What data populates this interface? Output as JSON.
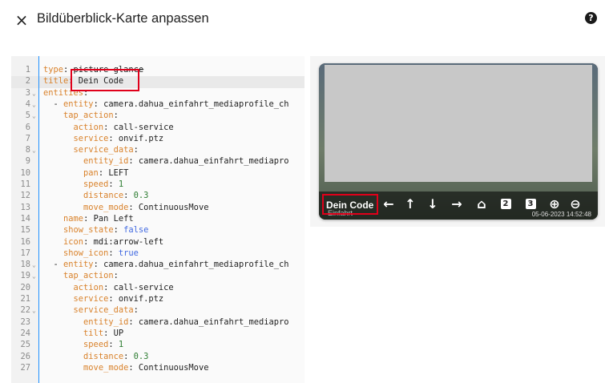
{
  "dialog": {
    "title": "Bildüberblick-Karte anpassen",
    "close_icon": "×",
    "help_icon": "?"
  },
  "editor": {
    "lines": [
      {
        "n": "1",
        "fold": "",
        "segs": [
          {
            "t": "type",
            "c": "k"
          },
          {
            "t": ": ",
            "c": "v"
          },
          {
            "t": "picture-glance",
            "c": "v",
            "s": "strike"
          }
        ]
      },
      {
        "n": "2",
        "fold": "",
        "active": true,
        "segs": [
          {
            "t": "title",
            "c": "k"
          },
          {
            "t": ": Dein Code",
            "c": "v"
          }
        ]
      },
      {
        "n": "3",
        "fold": "⌄",
        "segs": [
          {
            "t": "entities",
            "c": "k"
          },
          {
            "t": ":",
            "c": "v"
          }
        ]
      },
      {
        "n": "4",
        "fold": "⌄",
        "segs": [
          {
            "t": "  - ",
            "c": "dash"
          },
          {
            "t": "entity",
            "c": "k"
          },
          {
            "t": ": camera.dahua_einfahrt_mediaprofile_ch",
            "c": "v"
          }
        ]
      },
      {
        "n": "5",
        "fold": "⌄",
        "segs": [
          {
            "t": "    ",
            "c": "v"
          },
          {
            "t": "tap_action",
            "c": "k"
          },
          {
            "t": ":",
            "c": "v"
          }
        ]
      },
      {
        "n": "6",
        "fold": "",
        "segs": [
          {
            "t": "      ",
            "c": "v"
          },
          {
            "t": "action",
            "c": "k"
          },
          {
            "t": ": call-service",
            "c": "v"
          }
        ]
      },
      {
        "n": "7",
        "fold": "",
        "segs": [
          {
            "t": "      ",
            "c": "v"
          },
          {
            "t": "service",
            "c": "k"
          },
          {
            "t": ": onvif.ptz",
            "c": "v"
          }
        ]
      },
      {
        "n": "8",
        "fold": "⌄",
        "segs": [
          {
            "t": "      ",
            "c": "v"
          },
          {
            "t": "service_data",
            "c": "k"
          },
          {
            "t": ":",
            "c": "v"
          }
        ]
      },
      {
        "n": "9",
        "fold": "",
        "segs": [
          {
            "t": "        ",
            "c": "v"
          },
          {
            "t": "entity_id",
            "c": "k"
          },
          {
            "t": ": camera.dahua_einfahrt_mediapro",
            "c": "v"
          }
        ]
      },
      {
        "n": "10",
        "fold": "",
        "segs": [
          {
            "t": "        ",
            "c": "v"
          },
          {
            "t": "pan",
            "c": "k"
          },
          {
            "t": ": LEFT",
            "c": "v"
          }
        ]
      },
      {
        "n": "11",
        "fold": "",
        "segs": [
          {
            "t": "        ",
            "c": "v"
          },
          {
            "t": "speed",
            "c": "k"
          },
          {
            "t": ": ",
            "c": "v"
          },
          {
            "t": "1",
            "c": "n"
          }
        ]
      },
      {
        "n": "12",
        "fold": "",
        "segs": [
          {
            "t": "        ",
            "c": "v"
          },
          {
            "t": "distance",
            "c": "k"
          },
          {
            "t": ": ",
            "c": "v"
          },
          {
            "t": "0.3",
            "c": "n"
          }
        ]
      },
      {
        "n": "13",
        "fold": "",
        "segs": [
          {
            "t": "        ",
            "c": "v"
          },
          {
            "t": "move_mode",
            "c": "k"
          },
          {
            "t": ": ContinuousMove",
            "c": "v"
          }
        ]
      },
      {
        "n": "14",
        "fold": "",
        "segs": [
          {
            "t": "    ",
            "c": "v"
          },
          {
            "t": "name",
            "c": "k"
          },
          {
            "t": ": Pan Left",
            "c": "v"
          }
        ]
      },
      {
        "n": "15",
        "fold": "",
        "segs": [
          {
            "t": "    ",
            "c": "v"
          },
          {
            "t": "show_state",
            "c": "k"
          },
          {
            "t": ": ",
            "c": "v"
          },
          {
            "t": "false",
            "c": "b"
          }
        ]
      },
      {
        "n": "16",
        "fold": "",
        "segs": [
          {
            "t": "    ",
            "c": "v"
          },
          {
            "t": "icon",
            "c": "k"
          },
          {
            "t": ": mdi:arrow-left",
            "c": "v"
          }
        ]
      },
      {
        "n": "17",
        "fold": "",
        "segs": [
          {
            "t": "    ",
            "c": "v"
          },
          {
            "t": "show_icon",
            "c": "k"
          },
          {
            "t": ": ",
            "c": "v"
          },
          {
            "t": "true",
            "c": "b"
          }
        ]
      },
      {
        "n": "18",
        "fold": "⌄",
        "segs": [
          {
            "t": "  - ",
            "c": "dash"
          },
          {
            "t": "entity",
            "c": "k"
          },
          {
            "t": ": camera.dahua_einfahrt_mediaprofile_ch",
            "c": "v"
          }
        ]
      },
      {
        "n": "19",
        "fold": "⌄",
        "segs": [
          {
            "t": "    ",
            "c": "v"
          },
          {
            "t": "tap_action",
            "c": "k"
          },
          {
            "t": ":",
            "c": "v"
          }
        ]
      },
      {
        "n": "20",
        "fold": "",
        "segs": [
          {
            "t": "      ",
            "c": "v"
          },
          {
            "t": "action",
            "c": "k"
          },
          {
            "t": ": call-service",
            "c": "v"
          }
        ]
      },
      {
        "n": "21",
        "fold": "",
        "segs": [
          {
            "t": "      ",
            "c": "v"
          },
          {
            "t": "service",
            "c": "k"
          },
          {
            "t": ": onvif.ptz",
            "c": "v"
          }
        ]
      },
      {
        "n": "22",
        "fold": "⌄",
        "segs": [
          {
            "t": "      ",
            "c": "v"
          },
          {
            "t": "service_data",
            "c": "k"
          },
          {
            "t": ":",
            "c": "v"
          }
        ]
      },
      {
        "n": "23",
        "fold": "",
        "segs": [
          {
            "t": "        ",
            "c": "v"
          },
          {
            "t": "entity_id",
            "c": "k"
          },
          {
            "t": ": camera.dahua_einfahrt_mediapro",
            "c": "v"
          }
        ]
      },
      {
        "n": "24",
        "fold": "",
        "segs": [
          {
            "t": "        ",
            "c": "v"
          },
          {
            "t": "tilt",
            "c": "k"
          },
          {
            "t": ": UP",
            "c": "v"
          }
        ]
      },
      {
        "n": "25",
        "fold": "",
        "segs": [
          {
            "t": "        ",
            "c": "v"
          },
          {
            "t": "speed",
            "c": "k"
          },
          {
            "t": ": ",
            "c": "v"
          },
          {
            "t": "1",
            "c": "n"
          }
        ]
      },
      {
        "n": "26",
        "fold": "",
        "segs": [
          {
            "t": "        ",
            "c": "v"
          },
          {
            "t": "distance",
            "c": "k"
          },
          {
            "t": ": ",
            "c": "v"
          },
          {
            "t": "0.3",
            "c": "n"
          }
        ]
      },
      {
        "n": "27",
        "fold": "",
        "segs": [
          {
            "t": "        ",
            "c": "v"
          },
          {
            "t": "move_mode",
            "c": "k"
          },
          {
            "t": ": ContinuousMove",
            "c": "v"
          }
        ]
      }
    ]
  },
  "preview": {
    "card_title": "Dein Code",
    "card_subtitle": "Einfahrt",
    "timestamp": "05-06-2023 14:52:48",
    "controls": [
      {
        "icon": "arrow-left-icon",
        "glyph": "←"
      },
      {
        "icon": "arrow-up-icon",
        "glyph": "↑"
      },
      {
        "icon": "arrow-down-icon",
        "glyph": "↓"
      },
      {
        "icon": "arrow-right-icon",
        "glyph": "→"
      },
      {
        "icon": "home-icon",
        "glyph": "⌂"
      },
      {
        "icon": "preset-2-icon",
        "glyph": "2",
        "box": true
      },
      {
        "icon": "preset-3-icon",
        "glyph": "3",
        "box": true
      },
      {
        "icon": "zoom-in-icon",
        "glyph": "⊕"
      },
      {
        "icon": "zoom-out-icon",
        "glyph": "⊖"
      }
    ]
  },
  "colors": {
    "key": "#d9822b",
    "number": "#2e7d32",
    "boolean": "#4169e1",
    "highlight": "#e0001a",
    "caret": "#1e90ff"
  }
}
